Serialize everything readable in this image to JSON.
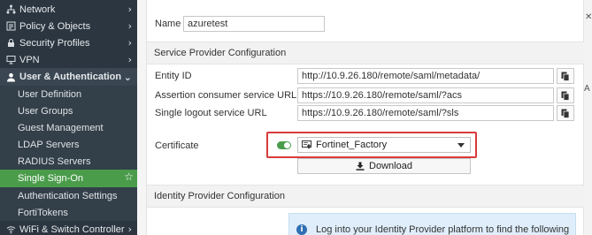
{
  "sidebar": {
    "items": [
      {
        "label": "Network",
        "icon": "network-icon",
        "type": "top",
        "chevron": true
      },
      {
        "label": "Policy & Objects",
        "icon": "policy-icon",
        "type": "top",
        "chevron": true
      },
      {
        "label": "Security Profiles",
        "icon": "lock-icon",
        "type": "top",
        "chevron": true
      },
      {
        "label": "VPN",
        "icon": "monitor-icon",
        "type": "top",
        "chevron": true
      },
      {
        "label": "User & Authentication",
        "icon": "user-icon",
        "type": "section",
        "chevron": true
      },
      {
        "label": "User Definition",
        "type": "sub"
      },
      {
        "label": "User Groups",
        "type": "sub"
      },
      {
        "label": "Guest Management",
        "type": "sub"
      },
      {
        "label": "LDAP Servers",
        "type": "sub"
      },
      {
        "label": "RADIUS Servers",
        "type": "sub"
      },
      {
        "label": "Single Sign-On",
        "type": "active"
      },
      {
        "label": "Authentication Settings",
        "type": "sub"
      },
      {
        "label": "FortiTokens",
        "type": "sub"
      },
      {
        "label": "WiFi & Switch Controller",
        "icon": "wifi-icon",
        "type": "top",
        "chevron": true
      }
    ]
  },
  "form": {
    "name_label": "Name",
    "name_value": "azuretest",
    "sp_section": "Service Provider Configuration",
    "entity_id_label": "Entity ID",
    "entity_id_value": "http://10.9.26.180/remote/saml/metadata/",
    "acs_label": "Assertion consumer service URL",
    "acs_value": "https://10.9.26.180/remote/saml/?acs",
    "slo_label": "Single logout service URL",
    "slo_value": "https://10.9.26.180/remote/saml/?sls",
    "certificate_label": "Certificate",
    "certificate_value": "Fortinet_Factory",
    "download_label": "Download",
    "idp_section": "Identity Provider Configuration",
    "info_text": "Log into your Identity Provider platform to find the following"
  },
  "colors": {
    "sidebar_bg": "#2b3640",
    "active_green": "#4a9c4b",
    "highlight_red": "#d93b3b",
    "info_bg": "#dfeefa"
  }
}
